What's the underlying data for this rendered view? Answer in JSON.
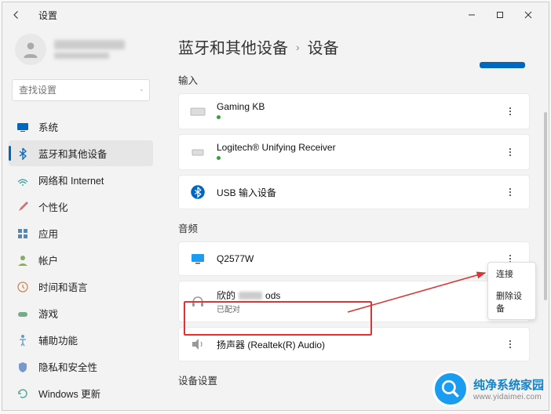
{
  "titlebar": {
    "title": "设置"
  },
  "sidebar": {
    "search_placeholder": "查找设置",
    "items": [
      {
        "label": "系统"
      },
      {
        "label": "蓝牙和其他设备"
      },
      {
        "label": "网络和 Internet"
      },
      {
        "label": "个性化"
      },
      {
        "label": "应用"
      },
      {
        "label": "帐户"
      },
      {
        "label": "时间和语言"
      },
      {
        "label": "游戏"
      },
      {
        "label": "辅助功能"
      },
      {
        "label": "隐私和安全性"
      },
      {
        "label": "Windows 更新"
      }
    ]
  },
  "breadcrumbs": {
    "parent": "蓝牙和其他设备",
    "sep": "›",
    "current": "设备"
  },
  "sections": {
    "input": {
      "label": "输入",
      "devices": [
        {
          "name": "Gaming KB",
          "status": "",
          "connected": true
        },
        {
          "name": "Logitech® Unifying Receiver",
          "status": "",
          "connected": true
        },
        {
          "name": "USB 输入设备",
          "status": "",
          "connected": false
        }
      ]
    },
    "audio": {
      "label": "音频",
      "devices": [
        {
          "name": "Q2577W",
          "status": "",
          "connected": false
        },
        {
          "name_prefix": "欣的",
          "name_suffix": "ods",
          "status": "已配对",
          "connected": false
        },
        {
          "name": "扬声器 (Realtek(R) Audio)",
          "status": "",
          "connected": false
        }
      ]
    },
    "device_settings": {
      "label": "设备设置"
    }
  },
  "context_menu": {
    "items": [
      {
        "label": "连接"
      },
      {
        "label": "删除设备"
      }
    ]
  },
  "watermark": {
    "line1": "纯净系统家园",
    "line2": "www.yidaimei.com"
  }
}
